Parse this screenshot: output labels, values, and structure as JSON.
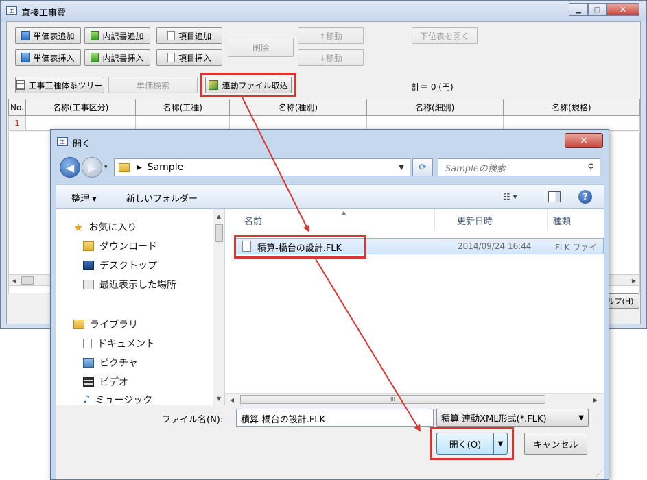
{
  "main_window": {
    "title": "直接工事費",
    "toolbar": {
      "tanka_add": "単価表追加",
      "uchiwake_add": "内訳書追加",
      "item_add": "項目追加",
      "tanka_insert": "単価表挿入",
      "uchiwake_insert": "内訳書挿入",
      "item_insert": "項目挿入",
      "delete": "削除",
      "move_up": "↑移動",
      "move_down": "↓移動",
      "open_sub": "下位表を開く",
      "tree": "工事工種体系ツリー",
      "tanka_search": "単価検索",
      "linked_import": "連動ファイル取込",
      "total": "計＝ 0 (円)"
    },
    "grid": {
      "columns": [
        "No.",
        "名称(工事区分)",
        "名称(工種)",
        "名称(種別)",
        "名称(細別)",
        "名称(規格)"
      ],
      "rows": [
        [
          "1",
          "",
          "",
          "",
          "",
          ""
        ]
      ]
    },
    "help_button": "ルプ(H)"
  },
  "open_dialog": {
    "title": "開く",
    "path_folder": "Sample",
    "search_placeholder": "Sampleの検索",
    "organize": "整理 ▾",
    "new_folder": "新しいフォルダー",
    "nav": {
      "favorites": "お気に入り",
      "downloads": "ダウンロード",
      "desktop": "デスクトップ",
      "recent": "最近表示した場所",
      "libraries": "ライブラリ",
      "documents": "ドキュメント",
      "pictures": "ピクチャ",
      "videos": "ビデオ",
      "music": "ミュージック"
    },
    "columns": {
      "name": "名前",
      "modified": "更新日時",
      "type": "種類"
    },
    "files": [
      {
        "name": "積算-橋台の設計.FLK",
        "modified": "2014/09/24 16:44",
        "type": "FLK ファイ"
      }
    ],
    "filename_label": "ファイル名(N):",
    "filename_value": "積算-橋台の設計.FLK",
    "filetype": "積算 連動XML形式(*.FLK)",
    "open_button": "開く(O)",
    "cancel_button": "キャンセル",
    "hscroll_thumb": "III"
  },
  "colors": {
    "highlight": "#d9362f",
    "accent": "#3c6fb0"
  }
}
